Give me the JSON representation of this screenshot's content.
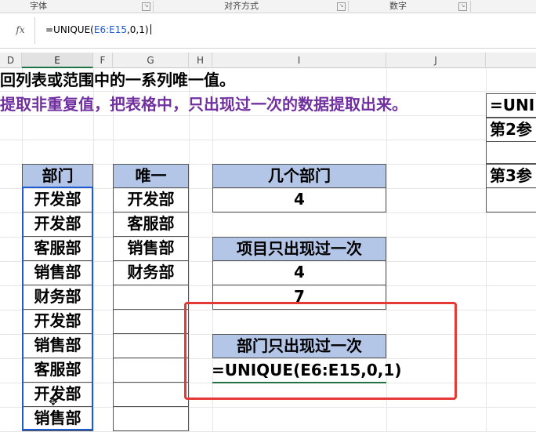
{
  "ribbon": {
    "groups": [
      "字体",
      "对齐方式",
      "数字"
    ]
  },
  "formula_bar": {
    "fx_label": "fx",
    "prefix": "=UNIQUE(",
    "ref": "E6:E15",
    "suffix": ",0,1)"
  },
  "columns": [
    "D",
    "E",
    "F",
    "G",
    "H",
    "I",
    "J"
  ],
  "description": {
    "line1": "回列表或范围中的一系列唯一值。",
    "line2": "提取非重复值，把表格中，只出现过一次的数据提取出来。"
  },
  "side_notes": [
    "=UNI",
    "第2参",
    "第3参"
  ],
  "dept_table": {
    "header": "部门",
    "rows": [
      "开发部",
      "开发部",
      "客服部",
      "销售部",
      "财务部",
      "开发部",
      "销售部",
      "客服部",
      "开发部",
      "销售部"
    ]
  },
  "unique_table": {
    "header": "唯一",
    "rows": [
      "开发部",
      "客服部",
      "销售部",
      "财务部",
      "",
      "",
      "",
      "",
      "",
      ""
    ]
  },
  "results": {
    "count_header": "几个部门",
    "count_value": "4",
    "once_header": "项目只出现过一次",
    "once_values": [
      "4",
      "7"
    ],
    "dept_once_header": "部门只出现过一次",
    "formula_input": "=UNIQUE(E6:E15,0,1)"
  },
  "colors": {
    "header_fill": "#b4c6e7",
    "selection": "#1f5bd0",
    "annotation": "#e53935",
    "purple_text": "#7030a0"
  }
}
